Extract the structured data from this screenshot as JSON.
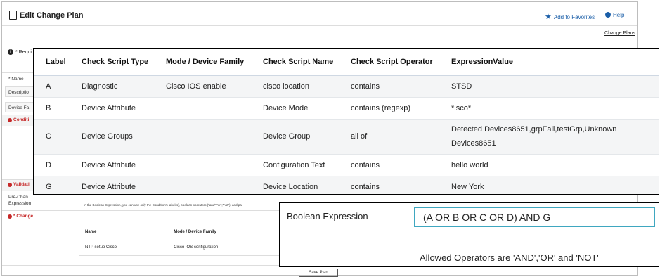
{
  "page": {
    "title": "Edit Change Plan",
    "add_to_favorites": "Add to Favorites",
    "help": "Help",
    "change_plans": "Change Plans",
    "required_note": "* Requi"
  },
  "form": {
    "name_label": "* Name",
    "description_label": "Descriptio",
    "device_family_label": "Device Fa",
    "conditions_label": "Conditi",
    "validation_label": "Validati",
    "pre_change_label": "Pre-Chan",
    "expression_label": "Expression",
    "change_label": "* Change",
    "boolean_note": "In the Boolean Expression, you can use only the Condition's label(s), boolean operators (\"and\",\"or\",\"not\"), and pa"
  },
  "change_table": {
    "headers": [
      "Name",
      "Mode / Device Family"
    ],
    "rows": [
      [
        "NTP setup Cisco",
        "Cisco IOS configuration"
      ]
    ]
  },
  "save_button": "Save Plan",
  "conditions": {
    "headers": [
      "Label",
      "Check Script Type",
      "Mode / Device Family",
      "Check Script Name",
      "Check Script Operator",
      "ExpressionValue"
    ],
    "rows": [
      {
        "label": "A",
        "type": "Diagnostic",
        "mode": "Cisco IOS enable",
        "name": "cisco location",
        "operator": "contains",
        "value": "STSD"
      },
      {
        "label": "B",
        "type": "Device Attribute",
        "mode": "",
        "name": "Device Model",
        "operator": "contains (regexp)",
        "value": "*isco*"
      },
      {
        "label": "C",
        "type": "Device Groups",
        "mode": "",
        "name": "Device Group",
        "operator": "all of",
        "value": "Detected Devices8651,grpFail,testGrp,Unknown Devices8651"
      },
      {
        "label": "D",
        "type": "Device Attribute",
        "mode": "",
        "name": "Configuration Text",
        "operator": "contains",
        "value": "hello world"
      },
      {
        "label": "G",
        "type": "Device Attribute",
        "mode": "",
        "name": "Device Location",
        "operator": "contains",
        "value": "New York"
      }
    ]
  },
  "boolean": {
    "label": "Boolean Expression",
    "value": "(A OR B OR C OR D) AND G",
    "help": "Allowed Operators are 'AND','OR' and 'NOT'"
  },
  "colors": {
    "link": "#1a5ea8",
    "required_red": "#c62828",
    "input_border": "#3fa7c0"
  }
}
